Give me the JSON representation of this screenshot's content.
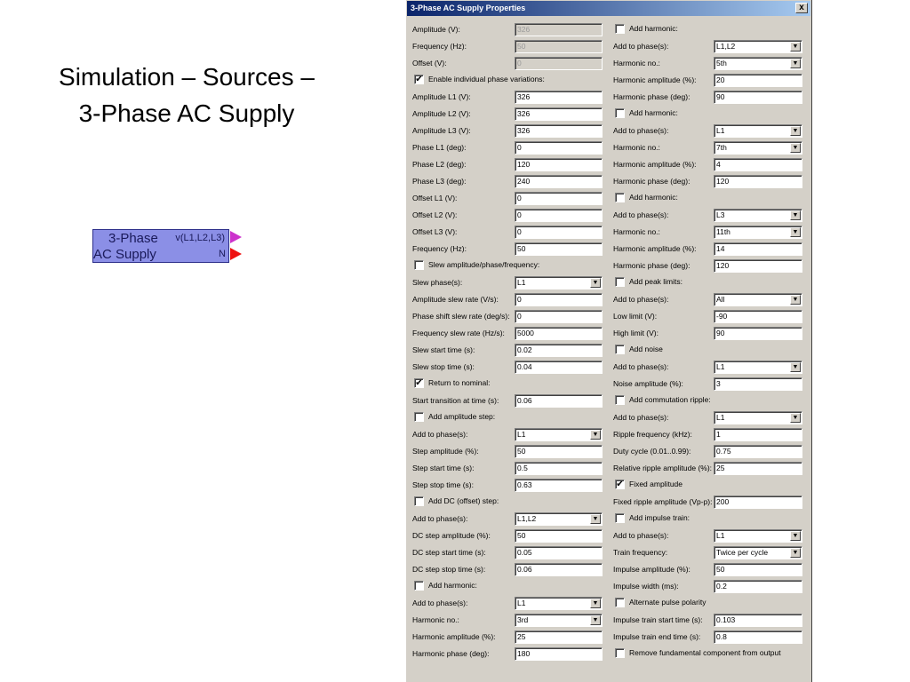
{
  "slide": {
    "title_line1": "Simulation – Sources –",
    "title_line2": "3-Phase AC Supply"
  },
  "block": {
    "line1": "3-Phase",
    "line2": "AC Supply",
    "port_out": "v(L1,L2,L3)",
    "port_n": "N",
    "port_out_color": "#cc33cc",
    "port_n_color": "#ee1111"
  },
  "dialog": {
    "title": "3-Phase AC Supply  Properties",
    "close_label": "x",
    "left": {
      "amplitude_label": "Amplitude (V):",
      "amplitude_value": "326",
      "frequency_label": "Frequency (Hz):",
      "frequency_value": "50",
      "offset_label": "Offset (V):",
      "offset_value": "0",
      "enable_individual_label": "Enable individual phase variations:",
      "enable_individual_checked": "✔",
      "amplitude_l1_label": "Amplitude L1 (V):",
      "amplitude_l1_value": "326",
      "amplitude_l2_label": "Amplitude L2 (V):",
      "amplitude_l2_value": "326",
      "amplitude_l3_label": "Amplitude L3 (V):",
      "amplitude_l3_value": "326",
      "phase_l1_label": "Phase L1 (deg):",
      "phase_l1_value": "0",
      "phase_l2_label": "Phase L2 (deg):",
      "phase_l2_value": "120",
      "phase_l3_label": "Phase L3 (deg):",
      "phase_l3_value": "240",
      "offset_l1_label": "Offset L1 (V):",
      "offset_l1_value": "0",
      "offset_l2_label": "Offset L2 (V):",
      "offset_l2_value": "0",
      "offset_l3_label": "Offset L3 (V):",
      "offset_l3_value": "0",
      "frequency2_label": "Frequency (Hz):",
      "frequency2_value": "50",
      "slew_label": "Slew amplitude/phase/frequency:",
      "slew_checked": "",
      "slew_phases_label": "Slew phase(s):",
      "slew_phases_value": "L1",
      "amp_slew_rate_label": "Amplitude slew rate (V/s):",
      "amp_slew_rate_value": "0",
      "phase_shift_slew_label": "Phase shift slew rate (deg/s):",
      "phase_shift_slew_value": "0",
      "freq_slew_rate_label": "Frequency slew rate (Hz/s):",
      "freq_slew_rate_value": "5000",
      "slew_start_label": "Slew start time (s):",
      "slew_start_value": "0.02",
      "slew_stop_label": "Slew stop time (s):",
      "slew_stop_value": "0.04",
      "return_nominal_label": "Return to nominal:",
      "return_nominal_checked": "✔",
      "start_transition_label": "Start transition at time (s):",
      "start_transition_value": "0.06",
      "add_amp_step_label": "Add amplitude step:",
      "add_amp_step_checked": "",
      "add_to_phases_label": "Add to phase(s):",
      "add_to_phases_value": "L1",
      "step_amp_label": "Step amplitude (%):",
      "step_amp_value": "50",
      "step_start_label": "Step start time (s):",
      "step_start_value": "0.5",
      "step_stop_label": "Step stop time (s):",
      "step_stop_value": "0.63",
      "add_dc_step_label": "Add DC (offset) step:",
      "add_dc_step_checked": "",
      "dc_add_phases_label": "Add to phase(s):",
      "dc_add_phases_value": "L1,L2",
      "dc_step_amp_label": "DC step amplitude (%):",
      "dc_step_amp_value": "50",
      "dc_step_start_label": "DC step start time (s):",
      "dc_step_start_value": "0.05",
      "dc_step_stop_label": "DC step stop time (s):",
      "dc_step_stop_value": "0.06",
      "add_harmonic_label": "Add harmonic:",
      "add_harmonic_checked": "",
      "harm_add_phases_label": "Add to phase(s):",
      "harm_add_phases_value": "L1",
      "harm_no_label": "Harmonic no.:",
      "harm_no_value": "3rd",
      "harm_amp_label": "Harmonic amplitude (%):",
      "harm_amp_value": "25",
      "harm_phase_label": "Harmonic phase (deg):",
      "harm_phase_value": "180"
    },
    "right": {
      "h1_label": "Add harmonic:",
      "h1_checked": "",
      "h1_phases_label": "Add to phase(s):",
      "h1_phases_value": "L1,L2",
      "h1_no_label": "Harmonic no.:",
      "h1_no_value": "5th",
      "h1_amp_label": "Harmonic amplitude (%):",
      "h1_amp_value": "20",
      "h1_phase_label": "Harmonic phase (deg):",
      "h1_phase_value": "90",
      "h2_label": "Add harmonic:",
      "h2_checked": "",
      "h2_phases_label": "Add to phase(s):",
      "h2_phases_value": "L1",
      "h2_no_label": "Harmonic no.:",
      "h2_no_value": "7th",
      "h2_amp_label": "Harmonic amplitude (%):",
      "h2_amp_value": "4",
      "h2_phase_label": "Harmonic phase (deg):",
      "h2_phase_value": "120",
      "h3_label": "Add harmonic:",
      "h3_checked": "",
      "h3_phases_label": "Add to phase(s):",
      "h3_phases_value": "L3",
      "h3_no_label": "Harmonic no.:",
      "h3_no_value": "11th",
      "h3_amp_label": "Harmonic amplitude (%):",
      "h3_amp_value": "14",
      "h3_phase_label": "Harmonic phase (deg):",
      "h3_phase_value": "120",
      "peak_label": "Add peak limits:",
      "peak_checked": "",
      "peak_phases_label": "Add to phase(s):",
      "peak_phases_value": "All",
      "low_limit_label": "Low limit (V):",
      "low_limit_value": "-90",
      "high_limit_label": "High limit (V):",
      "high_limit_value": "90",
      "noise_label": "Add noise",
      "noise_checked": "",
      "noise_phases_label": "Add to phase(s):",
      "noise_phases_value": "L1",
      "noise_amp_label": "Noise amplitude (%):",
      "noise_amp_value": "3",
      "comm_label": "Add commutation ripple:",
      "comm_checked": "",
      "comm_phases_label": "Add to phase(s):",
      "comm_phases_value": "L1",
      "ripple_freq_label": "Ripple frequency (kHz):",
      "ripple_freq_value": "1",
      "duty_label": "Duty cycle (0.01..0.99):",
      "duty_value": "0.75",
      "rel_ripple_label": "Relative ripple amplitude (%):",
      "rel_ripple_value": "25",
      "fixed_amp_label": "Fixed amplitude",
      "fixed_amp_checked": "✔",
      "fixed_ripple_label": "Fixed ripple amplitude (Vp-p):",
      "fixed_ripple_value": "200",
      "impulse_label": "Add impulse train:",
      "impulse_checked": "",
      "impulse_phases_label": "Add to phase(s):",
      "impulse_phases_value": "L1",
      "train_freq_label": "Train frequency:",
      "train_freq_value": "Twice per cycle",
      "impulse_amp_label": "Impulse amplitude (%):",
      "impulse_amp_value": "50",
      "impulse_width_label": "Impulse width (ms):",
      "impulse_width_value": "0.2",
      "alt_polarity_label": "Alternate pulse polarity",
      "alt_polarity_checked": "",
      "train_start_label": "Impulse train start time (s):",
      "train_start_value": "0.103",
      "train_end_label": "Impulse train end time (s):",
      "train_end_value": "0.8",
      "remove_fund_label": "Remove fundamental component from output",
      "remove_fund_checked": ""
    }
  }
}
